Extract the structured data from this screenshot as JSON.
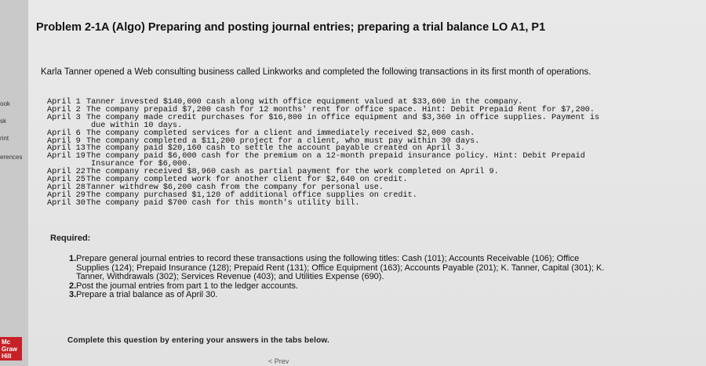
{
  "sidebar": {
    "items": [
      "ook",
      "sk",
      "rint",
      "erences"
    ],
    "logo": [
      "Mc",
      "Graw",
      "Hill"
    ]
  },
  "problem": {
    "title": "Problem 2-1A (Algo) Preparing and posting journal entries; preparing a trial balance LO A1, P1",
    "intro": "Karla Tanner opened a Web consulting business called Linkworks and completed the following transactions in its first month of operations."
  },
  "transactions": [
    {
      "date": "April 1",
      "text": "Tanner invested $140,000 cash along with office equipment valued at $33,600 in the company."
    },
    {
      "date": "April 2",
      "text": "The company prepaid $7,200 cash for 12 months' rent for office space. Hint: Debit Prepaid Rent for $7,200."
    },
    {
      "date": "April 3",
      "text": "The company made credit purchases for $16,800 in office equipment and $3,360 in office supplies. Payment is",
      "cont": "due within 10 days."
    },
    {
      "date": "April 6",
      "text": "The company completed services for a client and immediately received $2,000 cash."
    },
    {
      "date": "April 9",
      "text": "The company completed a $11,200 project for a client, who must pay within 30 days."
    },
    {
      "date": "April 13",
      "text": "The company paid $20,160 cash to settle the account payable created on April 3."
    },
    {
      "date": "April 19",
      "text": "The company paid $6,000 cash for the premium on a 12-month prepaid insurance policy. Hint: Debit Prepaid",
      "cont": "Insurance for $6,000."
    },
    {
      "date": "April 22",
      "text": "The company received $8,960 cash as partial payment for the work completed on April 9."
    },
    {
      "date": "April 25",
      "text": "The company completed work for another client for $2,640 on credit."
    },
    {
      "date": "April 28",
      "text": "Tanner withdrew $6,200 cash from the company for personal use."
    },
    {
      "date": "April 29",
      "text": "The company purchased $1,120 of additional office supplies on credit."
    },
    {
      "date": "April 30",
      "text": "The company paid $700 cash for this month's utility bill."
    }
  ],
  "required": {
    "heading": "Required:",
    "items": [
      {
        "num": "1.",
        "text": "Prepare general journal entries to record these transactions using the following titles: Cash (101); Accounts Receivable (106); Office Supplies (124); Prepaid Insurance (128); Prepaid Rent (131); Office Equipment (163); Accounts Payable (201); K. Tanner, Capital (301); K. Tanner, Withdrawals (302); Services Revenue (403); and Utilities Expense (690)."
      },
      {
        "num": "2.",
        "text": "Post the journal entries from part 1 to the ledger accounts."
      },
      {
        "num": "3.",
        "text": "Prepare a trial balance as of April 30."
      }
    ]
  },
  "footer": {
    "instruction": "Complete this question by entering your answers in the tabs below.",
    "prev_label": "< Prev"
  }
}
